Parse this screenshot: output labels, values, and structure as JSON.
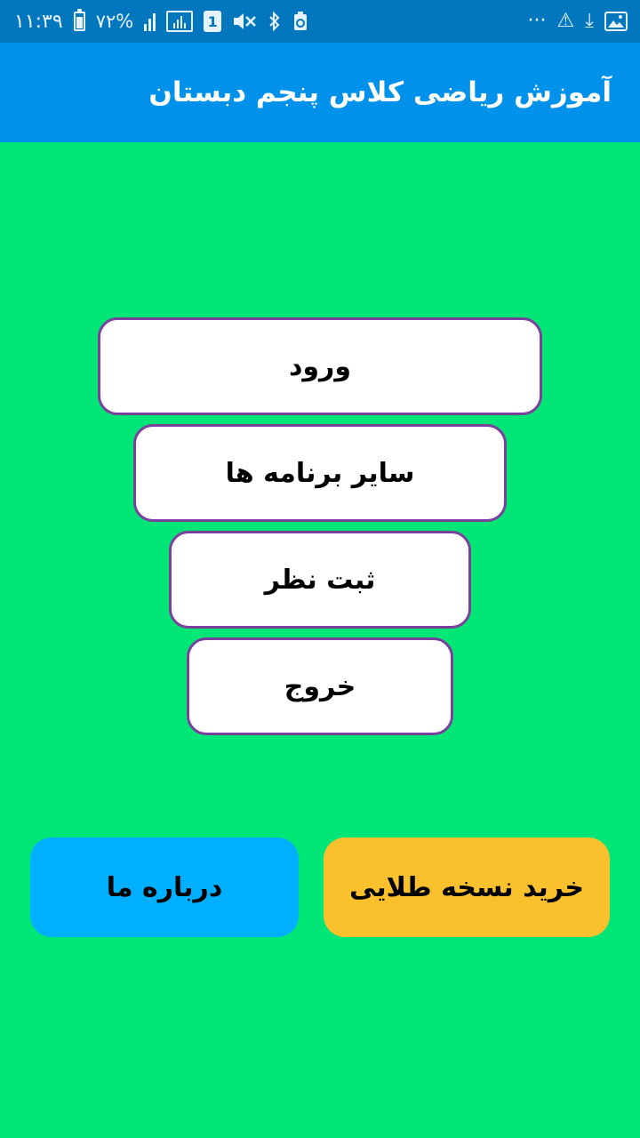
{
  "status_bar": {
    "time": "۱۱:۳۹",
    "battery_percent": "۷۲%",
    "sim_slot": "1",
    "icons": [
      "battery-icon",
      "signal-icon",
      "boxed-signal-icon",
      "sim-icon",
      "mute-vibrate-icon",
      "bluetooth-icon",
      "recycle-icon",
      "more-icon",
      "warning-icon",
      "download-icon",
      "image-icon"
    ],
    "more_glyph": "···",
    "warning_glyph": "⚠",
    "download_glyph": "⤓",
    "bluetooth_glyph": "✱"
  },
  "app_bar": {
    "title": "آموزش ریاضی کلاس پنجم دبستان"
  },
  "menu": {
    "login": "ورود",
    "other_apps": "سایر برنامه ها",
    "review": "ثبت نظر",
    "exit": "خروج"
  },
  "bottom": {
    "about": "درباره ما",
    "gold": "خرید نسخه طلایی"
  },
  "colors": {
    "background": "#00e676",
    "status_bar": "#0277bd",
    "app_bar": "#0091ea",
    "button_border": "#7b3f9e",
    "about_button": "#00b0ff",
    "gold_button": "#fbc02d"
  }
}
